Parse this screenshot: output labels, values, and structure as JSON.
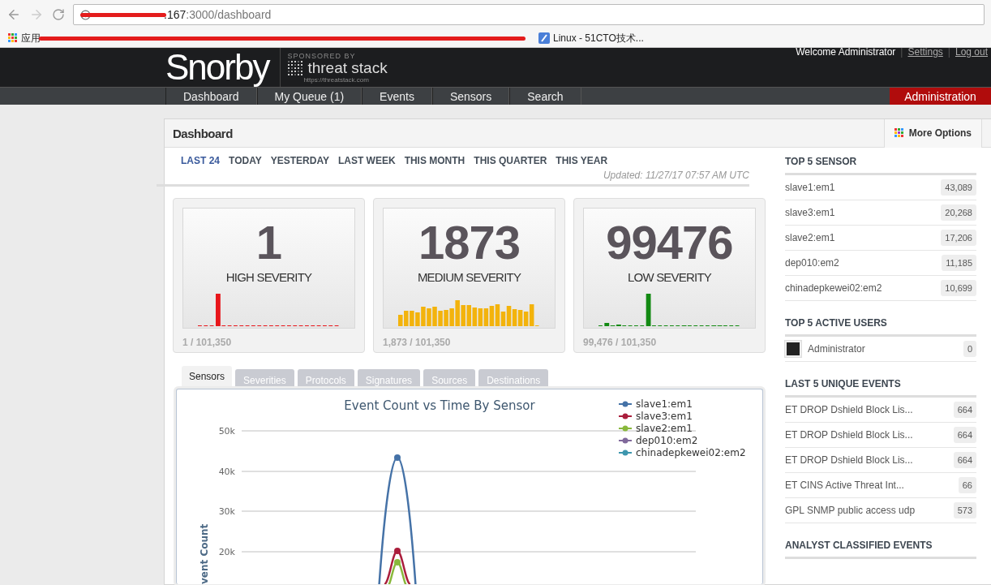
{
  "browser": {
    "url_visible": ".167",
    "url_rest": ":3000/dashboard",
    "bookmarks": [
      {
        "label": "应用",
        "kind": "apps"
      },
      {
        "label": "Linux - 51CTO技术...",
        "kind": "page"
      }
    ]
  },
  "header": {
    "logo": "Snorby",
    "sponsor_caption": "SPONSORED BY",
    "sponsor_name": "threat stack",
    "sponsor_url": "https://threatstack.com",
    "welcome": "Welcome Administrator",
    "separator": "|",
    "links": [
      "Settings",
      "Log out"
    ]
  },
  "nav": {
    "items": [
      {
        "label": "Dashboard"
      },
      {
        "label": "My Queue (1)"
      },
      {
        "label": "Events"
      },
      {
        "label": "Sensors"
      },
      {
        "label": "Search"
      }
    ],
    "admin": "Administration"
  },
  "panel": {
    "title": "Dashboard",
    "more_options": "More Options"
  },
  "ranges": [
    {
      "label": "LAST 24",
      "selected": true
    },
    {
      "label": "TODAY",
      "selected": false
    },
    {
      "label": "YESTERDAY",
      "selected": false
    },
    {
      "label": "LAST WEEK",
      "selected": false
    },
    {
      "label": "THIS MONTH",
      "selected": false
    },
    {
      "label": "THIS QUARTER",
      "selected": false
    },
    {
      "label": "THIS YEAR",
      "selected": false
    }
  ],
  "updated": "Updated: 11/27/17 07:57 AM UTC",
  "severities": [
    {
      "count": "1",
      "label": "HIGH SEVERITY",
      "ratio": "1 / 101,350",
      "color": "#e8161b",
      "kind": "high"
    },
    {
      "count": "1873",
      "label": "MEDIUM SEVERITY",
      "ratio": "1,873 / 101,350",
      "color": "#f3b30c",
      "kind": "medium"
    },
    {
      "count": "99476",
      "label": "LOW SEVERITY",
      "ratio": "99,476 / 101,350",
      "color": "#138a13",
      "kind": "low"
    }
  ],
  "chart_tabs": [
    {
      "label": "Sensors",
      "selected": true
    },
    {
      "label": "Severities",
      "selected": false
    },
    {
      "label": "Protocols",
      "selected": false
    },
    {
      "label": "Signatures",
      "selected": false
    },
    {
      "label": "Sources",
      "selected": false
    },
    {
      "label": "Destinations",
      "selected": false
    }
  ],
  "chart": {
    "title": "Event Count vs Time By Sensor",
    "ylabel": "vent Count",
    "yticks": [
      "50k",
      "40k",
      "30k",
      "20k"
    ],
    "legend": [
      {
        "name": "slave1:em1",
        "color": "#4572a7"
      },
      {
        "name": "slave3:em1",
        "color": "#aa1e3c"
      },
      {
        "name": "slave2:em1",
        "color": "#89b83c"
      },
      {
        "name": "dep010:em2",
        "color": "#80699b"
      },
      {
        "name": "chinadepkewei02:em2",
        "color": "#3d96ae"
      }
    ]
  },
  "sidebar": [
    {
      "title": "TOP 5 SENSOR",
      "kind": "list",
      "rows": [
        {
          "name": "slave1:em1",
          "count": "43,089"
        },
        {
          "name": "slave3:em1",
          "count": "20,268"
        },
        {
          "name": "slave2:em1",
          "count": "17,206"
        },
        {
          "name": "dep010:em2",
          "count": "11,185"
        },
        {
          "name": "chinadepkewei02:em2",
          "count": "10,699"
        }
      ]
    },
    {
      "title": "TOP 5 ACTIVE USERS",
      "kind": "users",
      "rows": [
        {
          "name": "Administrator",
          "count": "0"
        }
      ]
    },
    {
      "title": "LAST 5 UNIQUE EVENTS",
      "kind": "list",
      "rows": [
        {
          "name": "ET DROP Dshield Block Lis...",
          "count": "664"
        },
        {
          "name": "ET DROP Dshield Block Lis...",
          "count": "664"
        },
        {
          "name": "ET DROP Dshield Block Lis...",
          "count": "664"
        },
        {
          "name": "ET CINS Active Threat Int...",
          "count": "66"
        },
        {
          "name": "GPL SNMP public access udp",
          "count": "573"
        }
      ]
    },
    {
      "title": "ANALYST CLASSIFIED EVENTS",
      "kind": "list"
    }
  ]
}
